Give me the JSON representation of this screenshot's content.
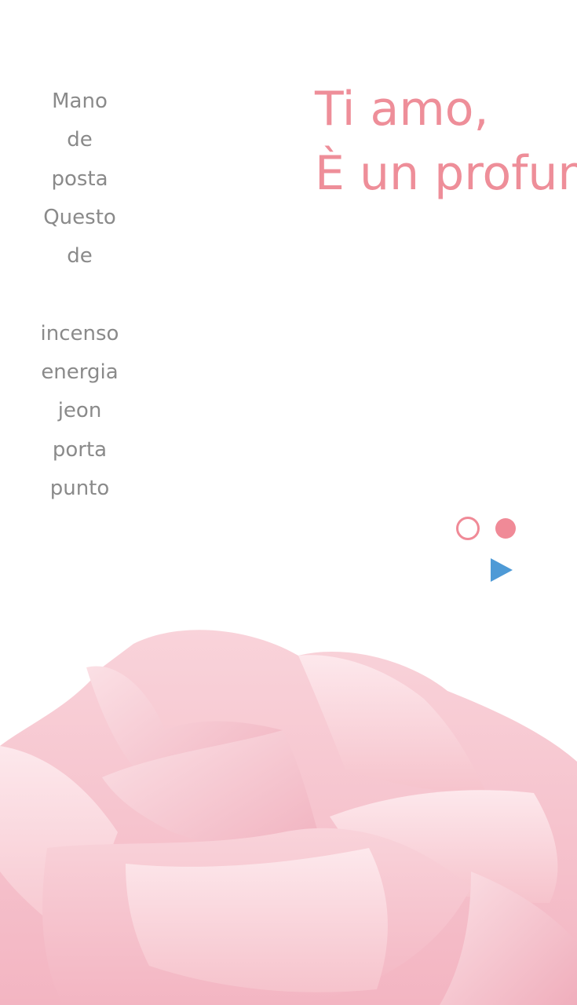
{
  "poem": {
    "lines": [
      "Mano",
      "de",
      "posta",
      "Questo",
      "de",
      "",
      "incenso",
      "energia",
      "jeon",
      "porta",
      "punto"
    ]
  },
  "headline": {
    "line1": "Ti amo,",
    "line2": "È un profun"
  },
  "carousel": {
    "active_index": 1,
    "count": 2
  },
  "colors": {
    "accent_pink": "#ee8e99",
    "play_blue": "#4e9ad6",
    "text_gray": "#8a8a8a",
    "rose_pink": "#f6c3cc"
  },
  "icons": {
    "play": "play-icon",
    "rose": "rose-image"
  }
}
